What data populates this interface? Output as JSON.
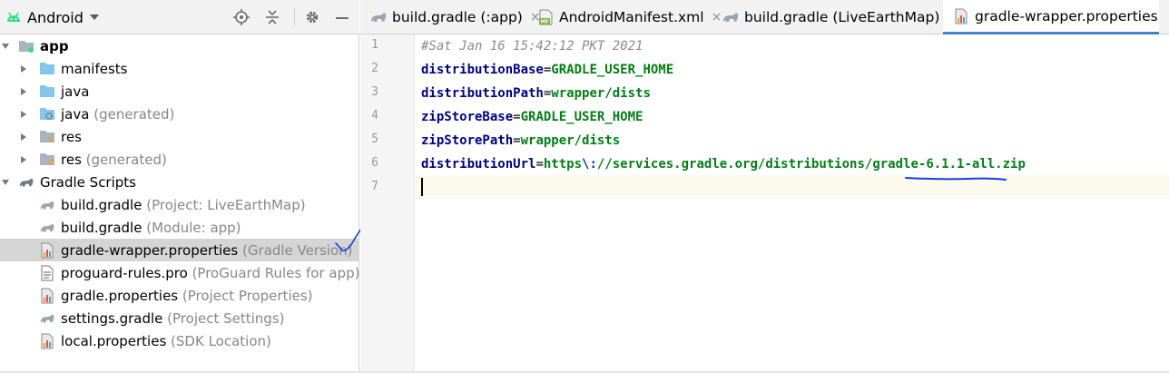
{
  "project_panel": {
    "view_selector": "Android",
    "toolbar_icons": [
      "locate-icon",
      "collapse-all-icon",
      "gear-icon",
      "minimize-icon"
    ],
    "tree": [
      {
        "label": "app",
        "hint": "",
        "icon": "module-folder-icon",
        "level": 0,
        "expanded": true,
        "bold": true
      },
      {
        "label": "manifests",
        "hint": "",
        "icon": "folder-icon",
        "level": 1,
        "expanded": false
      },
      {
        "label": "java",
        "hint": "",
        "icon": "folder-icon",
        "level": 1,
        "expanded": false
      },
      {
        "label": "java",
        "hint": "(generated)",
        "icon": "generated-folder-icon",
        "level": 1,
        "expanded": false
      },
      {
        "label": "res",
        "hint": "",
        "icon": "res-folder-icon",
        "level": 1,
        "expanded": false
      },
      {
        "label": "res",
        "hint": "(generated)",
        "icon": "res-folder-icon",
        "level": 1,
        "expanded": false
      },
      {
        "label": "Gradle Scripts",
        "hint": "",
        "icon": "gradle-icon",
        "level": 0,
        "expanded": true
      },
      {
        "label": "build.gradle",
        "hint": "(Project: LiveEarthMap)",
        "icon": "gradle-icon",
        "level": 1
      },
      {
        "label": "build.gradle",
        "hint": "(Module: app)",
        "icon": "gradle-icon",
        "level": 1
      },
      {
        "label": "gradle-wrapper.properties",
        "hint": "(Gradle Version)",
        "icon": "properties-icon",
        "level": 1,
        "selected": true
      },
      {
        "label": "proguard-rules.pro",
        "hint": "(ProGuard Rules for app)",
        "icon": "text-file-icon",
        "level": 1
      },
      {
        "label": "gradle.properties",
        "hint": "(Project Properties)",
        "icon": "properties-icon",
        "level": 1
      },
      {
        "label": "settings.gradle",
        "hint": "(Project Settings)",
        "icon": "gradle-icon",
        "level": 1
      },
      {
        "label": "local.properties",
        "hint": "(SDK Location)",
        "icon": "properties-icon",
        "level": 1
      }
    ]
  },
  "tabs": [
    {
      "label": "build.gradle (:app)",
      "icon": "gradle-icon",
      "closable": true,
      "active": false
    },
    {
      "label": "AndroidManifest.xml",
      "icon": "manifest-icon",
      "closable": true,
      "active": false
    },
    {
      "label": "build.gradle (LiveEarthMap)",
      "icon": "gradle-icon",
      "closable": true,
      "active": false
    },
    {
      "label": "gradle-wrapper.properties",
      "icon": "properties-icon",
      "closable": false,
      "active": true
    }
  ],
  "close_glyph": "×",
  "editor": {
    "line_numbers": [
      "1",
      "2",
      "3",
      "4",
      "5",
      "6",
      "7"
    ],
    "lines": [
      {
        "comment": "#Sat Jan 16 15:42:12 PKT 2021"
      },
      {
        "key": "distributionBase",
        "eq": "=",
        "value": "GRADLE_USER_HOME"
      },
      {
        "key": "distributionPath",
        "eq": "=",
        "value": "wrapper/dists"
      },
      {
        "key": "zipStoreBase",
        "eq": "=",
        "value": "GRADLE_USER_HOME"
      },
      {
        "key": "zipStorePath",
        "eq": "=",
        "value": "wrapper/dists"
      },
      {
        "key": "distributionUrl",
        "eq": "=",
        "value_a": "https",
        "escape": "\\:",
        "value_b": "//services.gradle.org/distributions/gradle-6.1.1-all.zip"
      },
      {}
    ],
    "current_line": "7"
  },
  "colors": {
    "key": "#000080",
    "value": "#067d17",
    "comment": "#8c8c8c",
    "annotation": "#1a3fd6",
    "selection": "#d5d5d5",
    "active_tab_underline": "#4083c9"
  }
}
